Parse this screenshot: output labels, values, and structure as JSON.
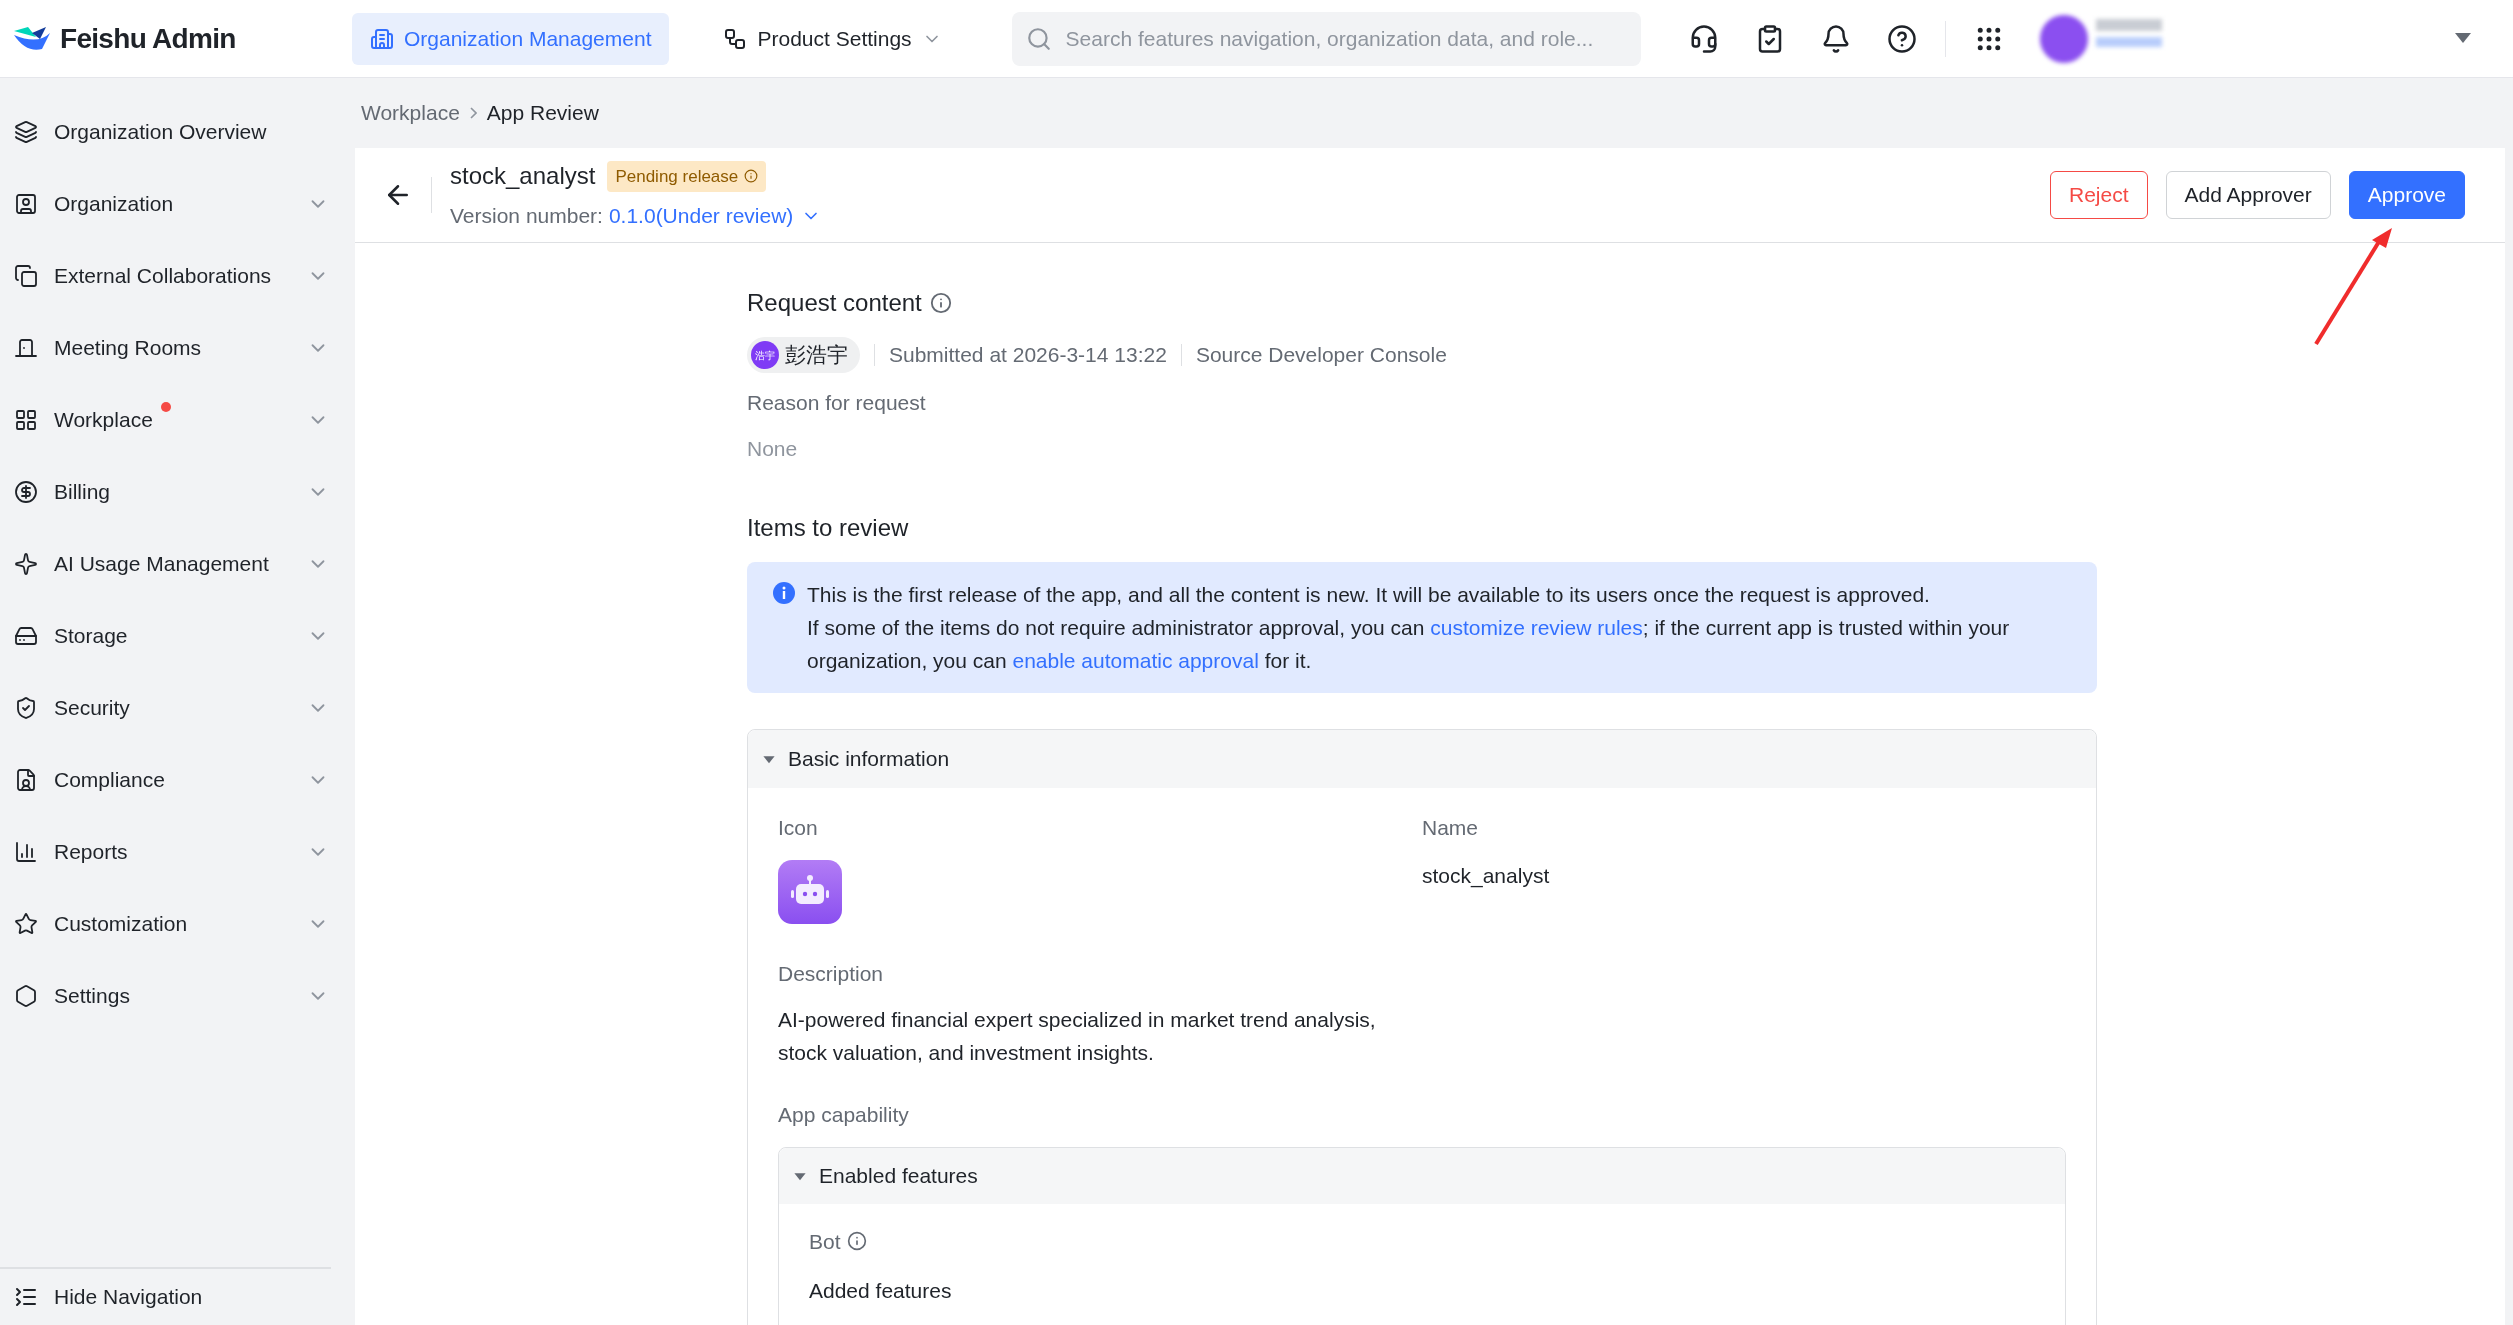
{
  "brand": "Feishu Admin",
  "top_tabs": [
    {
      "label": "Organization Management",
      "selected": true,
      "has_menu": false
    },
    {
      "label": "Product Settings",
      "selected": false,
      "has_menu": true
    }
  ],
  "search": {
    "placeholder": "Search features navigation, organization data, and role..."
  },
  "nav": [
    {
      "label": "Organization Overview",
      "expandable": false,
      "badge": false
    },
    {
      "label": "Organization",
      "expandable": true,
      "badge": false
    },
    {
      "label": "External Collaborations",
      "expandable": true,
      "badge": false
    },
    {
      "label": "Meeting Rooms",
      "expandable": true,
      "badge": false
    },
    {
      "label": "Workplace",
      "expandable": true,
      "badge": true
    },
    {
      "label": "Billing",
      "expandable": true,
      "badge": false
    },
    {
      "label": "AI Usage Management",
      "expandable": true,
      "badge": false
    },
    {
      "label": "Storage",
      "expandable": true,
      "badge": false
    },
    {
      "label": "Security",
      "expandable": true,
      "badge": false
    },
    {
      "label": "Compliance",
      "expandable": true,
      "badge": false
    },
    {
      "label": "Reports",
      "expandable": true,
      "badge": false
    },
    {
      "label": "Customization",
      "expandable": true,
      "badge": false
    },
    {
      "label": "Settings",
      "expandable": true,
      "badge": false
    }
  ],
  "hide_nav": "Hide Navigation",
  "breadcrumb": [
    "Workplace",
    "App Review"
  ],
  "app": {
    "name": "stock_analyst",
    "status": "Pending release",
    "version_label": "Version number:",
    "version": "0.1.0(Under review)"
  },
  "actions": [
    {
      "label": "Reject",
      "kind": "danger"
    },
    {
      "label": "Add Approver",
      "kind": "default"
    },
    {
      "label": "Approve",
      "kind": "primary"
    }
  ],
  "request": {
    "title": "Request content",
    "avatar_text": "浩宇",
    "requester": "彭浩宇",
    "submitted": "Submitted at 2026-3-14 13:22",
    "source": "Source Developer Console",
    "reason_label": "Reason for request",
    "reason": "None"
  },
  "review": {
    "title": "Items to review",
    "notice": [
      [
        {
          "kind": "text",
          "text": "This is the first release of the app, and all the content is new. It will be available to its users once the request is approved."
        }
      ],
      [
        {
          "kind": "text",
          "text": "If some of the items do not require administrator approval, you can "
        },
        {
          "kind": "link",
          "text": "customize review rules"
        },
        {
          "kind": "text",
          "text": "; if the current app is trusted within your organization, you can "
        },
        {
          "kind": "link",
          "text": "enable automatic approval"
        },
        {
          "kind": "text",
          "text": " for it."
        }
      ]
    ]
  },
  "basic": {
    "title": "Basic information",
    "expanded": true,
    "icon_label": "Icon",
    "name_label": "Name",
    "name": "stock_analyst",
    "description_label": "Description",
    "description": "AI-powered financial expert specialized in market trend analysis, stock valuation, and investment insights.",
    "capability_label": "App capability"
  },
  "features": {
    "title": "Enabled features",
    "expanded": true,
    "bot_label": "Bot",
    "added_label": "Added features"
  }
}
